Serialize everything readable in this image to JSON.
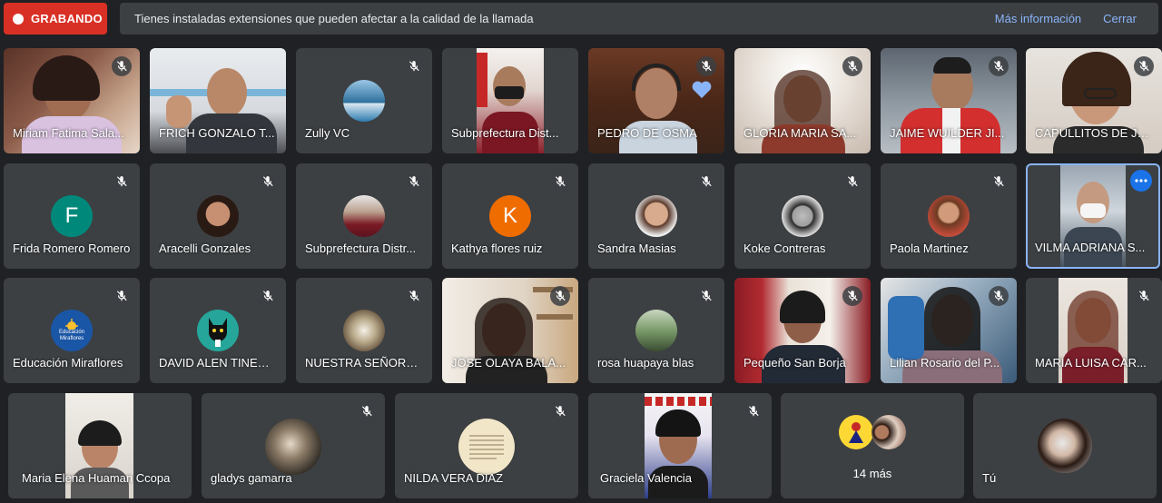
{
  "recording": {
    "label": "GRABANDO"
  },
  "notice": {
    "text": "Tienes instaladas extensiones que pueden afectar a la calidad de la llamada",
    "more_info": "Más información",
    "close": "Cerrar"
  },
  "participants": {
    "miriam": "Miriam Fatima Sala...",
    "frich": "FRICH GONZALO T...",
    "zully": "Zully VC",
    "subprefectura_dist": "Subprefectura Dist...",
    "pedro": "PEDRO DE OSMA",
    "gloria": "GLORIA MARIA SA...",
    "jaime": "JAIME WUILDER JI...",
    "capullitos": "CAPULLITOS DE JE...",
    "frida": "Frida Romero Romero",
    "aracelli": "Aracelli Gonzales",
    "subprefectura_distr": "Subprefectura Distr...",
    "kathya": "Kathya flores ruiz",
    "sandra": "Sandra Masias",
    "koke": "Koke Contreras",
    "paola": "Paola Martinez",
    "vilma": "VILMA ADRIANA S...",
    "educacion": "Educación Miraflores",
    "david": "DAVID ALEN TINEO ...",
    "nuestra": "NUESTRA SEÑORA ...",
    "jose": "JOSE OLAYA BALA...",
    "rosa": "rosa huapaya blas",
    "pequeno": "Pequeño San Borja",
    "lilian": "Lilian Rosario del P...",
    "maria_luisa": "MARIA LUISA CAR...",
    "maria_elena": "Maria Elena Huaman Ccopa",
    "gladys": "gladys gamarra",
    "nilda": "NILDA VERA DIAZ",
    "graciela": "Graciela Valencia",
    "tu": "Tú"
  },
  "avatars": {
    "frida": "F",
    "kathya": "K"
  },
  "logo": {
    "line1": "Educación",
    "line2": "Miraflores"
  },
  "more": {
    "label": "14 más"
  },
  "colors": {
    "record": "#d93025",
    "tile": "#3c4043",
    "background": "#202124",
    "accent": "#8ab4f8",
    "frida_avatar": "#00897b",
    "kathya_avatar": "#ef6c00",
    "heart": "#8ab4f8"
  }
}
